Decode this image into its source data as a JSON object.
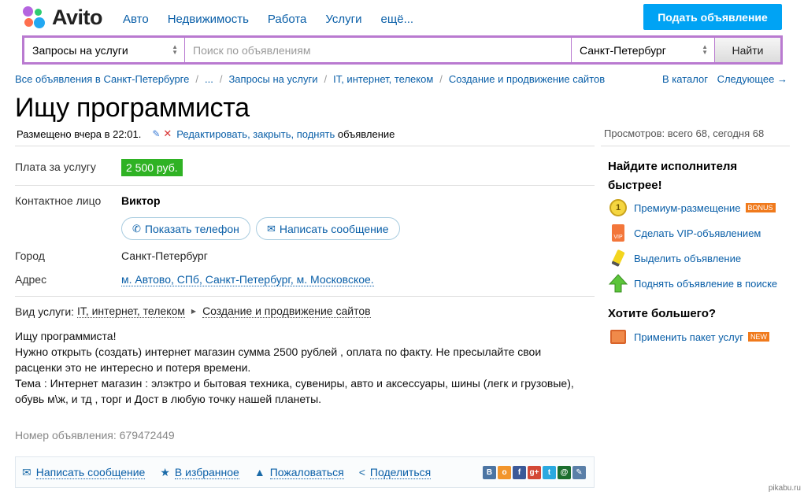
{
  "header": {
    "logo_text": "Avito",
    "nav": [
      "Авто",
      "Недвижимость",
      "Работа",
      "Услуги",
      "ещё..."
    ],
    "post_button": "Подать объявление"
  },
  "search": {
    "category": "Запросы на услуги",
    "placeholder": "Поиск по объявлениям",
    "city": "Санкт-Петербург",
    "find_button": "Найти"
  },
  "breadcrumbs": {
    "items": [
      "Все объявления в Санкт-Петербурге",
      "...",
      "Запросы на услуги",
      "IT, интернет, телеком",
      "Создание и продвижение сайтов"
    ],
    "catalog": "В каталог",
    "next": "Следующее →"
  },
  "ad": {
    "title": "Ищу программиста",
    "posted": "Размещено вчера в 22:01.",
    "edit_link": "Редактировать, закрыть, поднять",
    "edit_suffix": "объявление",
    "views": "Просмотров: всего 68, сегодня 68",
    "price_label": "Плата за услугу",
    "price": "2 500 руб.",
    "contact_label": "Контактное лицо",
    "contact_name": "Виктор",
    "show_phone": "Показать телефон",
    "write_message": "Написать сообщение",
    "city_label": "Город",
    "city": "Санкт-Петербург",
    "address_label": "Адрес",
    "address": "м. Автово, СПб, Санкт-Петербург, м. Московское.",
    "kind_label": "Вид услуги:",
    "kind_1": "IT, интернет, телеком",
    "kind_2": "Создание и продвижение сайтов",
    "description": [
      "Ищу программиста!",
      "Нужно открыть (создать) интернет магазин сумма 2500 рублей , оплата по факту. Не пресылайте свои расценки это не интересно и потеря времени.",
      "Тема : Интернет магазин : элэктро и бытовая техника, сувениры, авто и аксессуары, шины (легк и грузовые), обувь м\\ж, и тд , торг и Дост в любую точку нашей планеты."
    ],
    "ad_number": "Номер объявления: 679472449"
  },
  "actions": {
    "message": "Написать сообщение",
    "favorite": "В избранное",
    "complain": "Пожаловаться",
    "share": "Поделиться",
    "socials": [
      {
        "icon": "vk-icon",
        "glyph": "B",
        "color": "#4c75a3"
      },
      {
        "icon": "odnoklassniki-icon",
        "glyph": "o",
        "color": "#f2952c"
      },
      {
        "icon": "facebook-icon",
        "glyph": "f",
        "color": "#3b5998"
      },
      {
        "icon": "google-plus-icon",
        "glyph": "g+",
        "color": "#d34836"
      },
      {
        "icon": "twitter-icon",
        "glyph": "t",
        "color": "#2aa9e0"
      },
      {
        "icon": "mail-ru-icon",
        "glyph": "@",
        "color": "#1b6e2e"
      },
      {
        "icon": "livejournal-icon",
        "glyph": "✎",
        "color": "#5a7fa8"
      }
    ]
  },
  "sidebar": {
    "promo_title_1": "Найдите исполнителя",
    "promo_title_2": "быстрее!",
    "premium": "Премиум-размещение",
    "premium_badge": "BONUS",
    "vip": "Сделать VIP-объявлением",
    "highlight": "Выделить объявление",
    "raise": "Поднять объявление в поиске",
    "more_title": "Хотите большего?",
    "package": "Применить пакет услуг",
    "package_badge": "NEW"
  },
  "watermark": "pikabu.ru",
  "colors": {
    "accent": "#00a3f4",
    "search_border": "#b97ad0",
    "price": "#2fb224",
    "link": "#0a5fa8"
  }
}
